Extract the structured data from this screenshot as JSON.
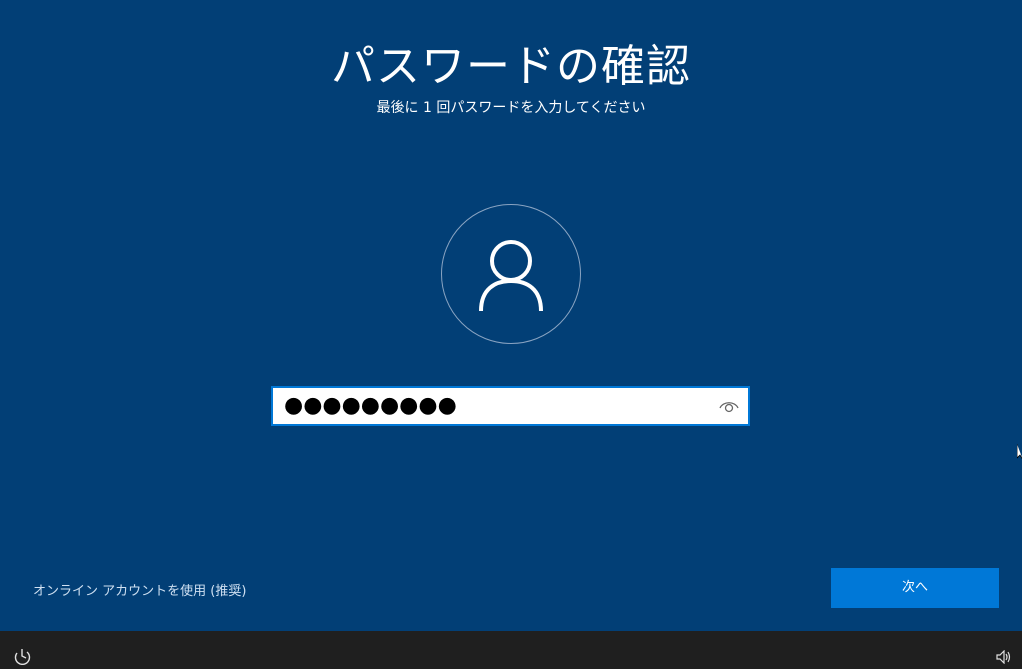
{
  "page": {
    "title": "パスワードの確認",
    "subtitle": "最後に 1 回パスワードを入力してください"
  },
  "avatar": {
    "icon": "user-icon"
  },
  "password_field": {
    "value": "●●●●●●●●●",
    "reveal_icon": "eye-icon"
  },
  "footer": {
    "online_account_link": "オンライン アカウントを使用 (推奨)",
    "next_label": "次へ"
  },
  "taskbar": {
    "left_icon": "ease-of-access-icon",
    "right_icon": "volume-icon"
  },
  "colors": {
    "background": "#023f76",
    "accent": "#0078d7",
    "taskbar": "#1f1f1f"
  }
}
